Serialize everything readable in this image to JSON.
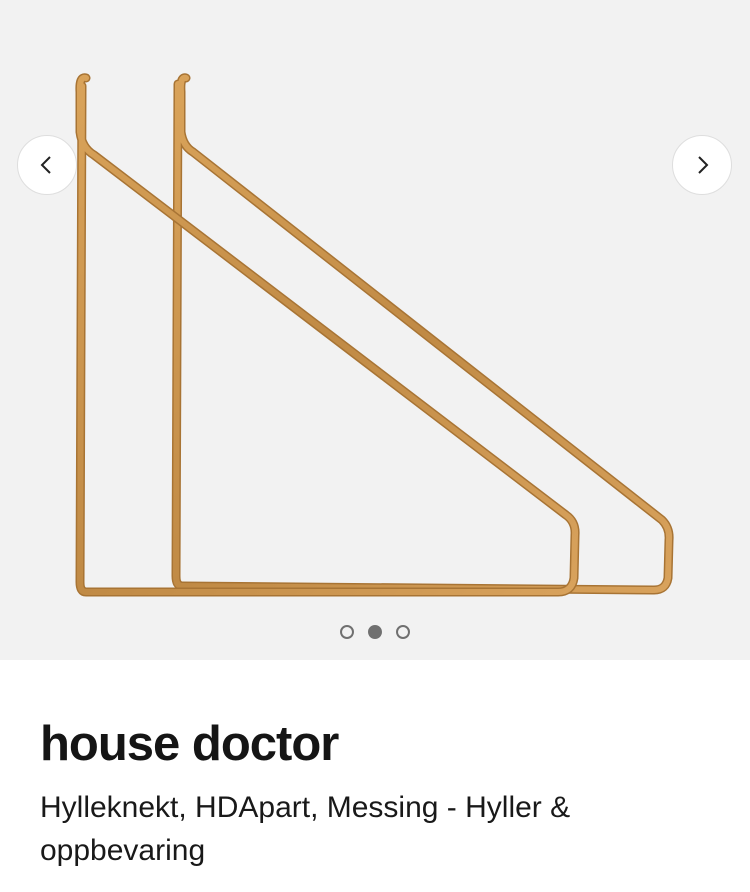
{
  "gallery": {
    "prev_icon": "chevron-left-icon",
    "next_icon": "chevron-right-icon",
    "slide_count": 3,
    "active_slide": 2,
    "image_subject": "brass wall shelf brackets",
    "colors": {
      "background": "#f2f2f2",
      "brass": "#c9944e",
      "dot": "#707070"
    }
  },
  "product": {
    "brand": "house doctor",
    "title": "Hylleknekt, HDApart, Messing - Hyller & oppbevaring"
  }
}
